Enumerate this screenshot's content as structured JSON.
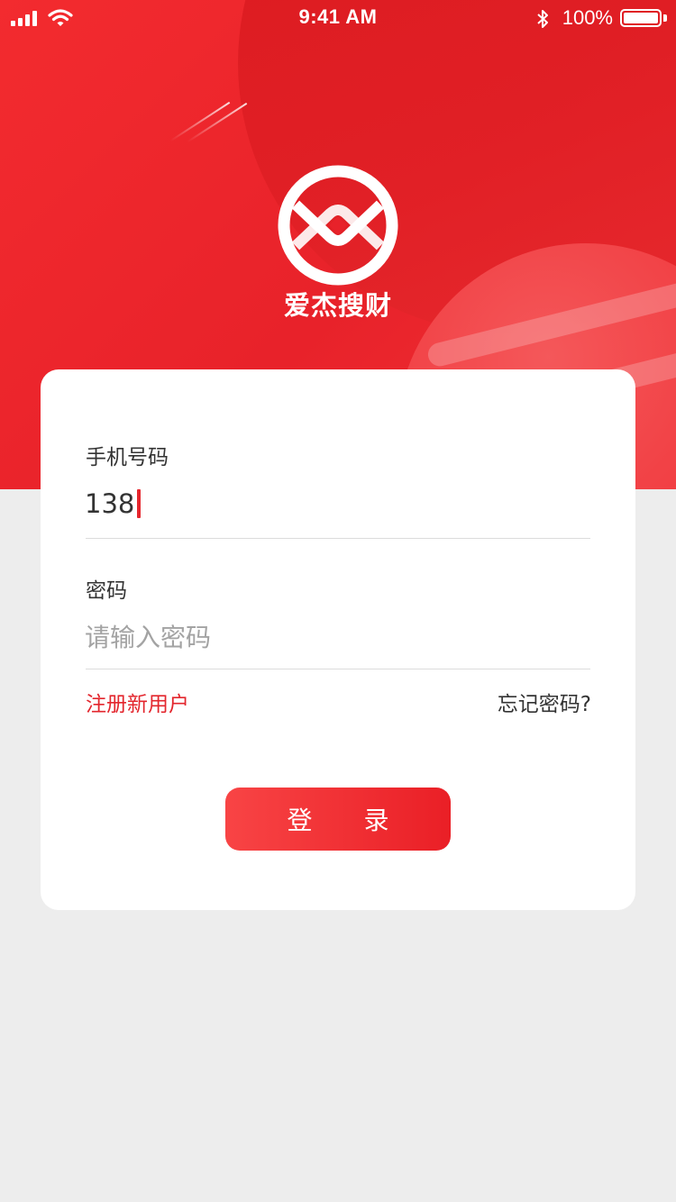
{
  "status_bar": {
    "time": "9:41 AM",
    "battery": "100%"
  },
  "brand": {
    "name": "爱杰搜财"
  },
  "form": {
    "phone": {
      "label": "手机号码",
      "value": "138"
    },
    "password": {
      "label": "密码",
      "placeholder": "请输入密码"
    },
    "register_link": "注册新用户",
    "forgot_link": "忘记密码?",
    "login_button": "登 录"
  },
  "colors": {
    "accent": "#e6262d",
    "background": "#ededed"
  },
  "icons": [
    "signal-icon",
    "wifi-icon",
    "bluetooth-icon",
    "battery-icon",
    "brand-logo-icon"
  ]
}
